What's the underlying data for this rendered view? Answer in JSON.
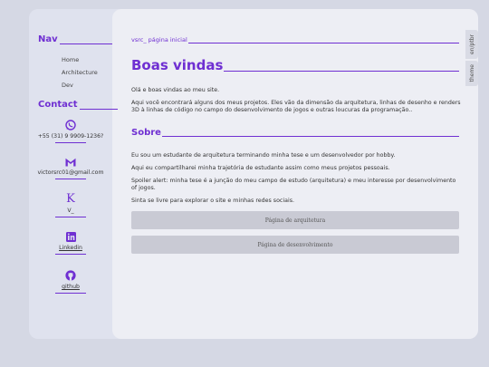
{
  "sidebar": {
    "nav_title": "Nav",
    "nav_items": [
      {
        "label": "Home"
      },
      {
        "label": "Architecture"
      },
      {
        "label": "Dev"
      }
    ],
    "contact_title": "Contact",
    "contacts": [
      {
        "icon": "whatsapp-icon",
        "text": "+55 (31) 9 9909-1236?"
      },
      {
        "icon": "gmail-icon",
        "text": "victorsrc01@gmail.com"
      },
      {
        "icon": "k-icon",
        "text": "V_"
      },
      {
        "icon": "linkedin-icon",
        "text": "Linkedin"
      },
      {
        "icon": "github-icon",
        "text": "github"
      }
    ]
  },
  "main": {
    "breadcrumb": "vsrc_ página inicial",
    "title": "Boas vindas",
    "intro": [
      "Olá e boas vindas ao meu site.",
      "Aqui você encontrará alguns dos meus projetos. Eles vão da dimensão da arquitetura, linhas de desenho e renders 3D à linhas de código no campo do desenvolvimento de jogos e outras loucuras da programação.."
    ],
    "about_title": "Sobre",
    "about": [
      "Eu sou um estudante de arquitetura terminando minha tese e um desenvolvedor por hobby.",
      "Aqui eu compartilharei minha trajetória de estudante assim como meus projetos pessoais.",
      "Spoiler alert: minha tese é a junção do meu campo de estudo (arquitetura) e meu interesse por desenvolvimento of jogos.",
      "Sinta se livre para explorar o site e minhas redes sociais."
    ],
    "buttons": [
      {
        "label": "Página de arquitetura"
      },
      {
        "label": "Página de desenvolvimento"
      }
    ]
  },
  "side_tabs": {
    "lang": "en/ptbr",
    "theme": "theme"
  },
  "colors": {
    "accent": "#6f2fd2",
    "background": "#d5d8e4"
  }
}
